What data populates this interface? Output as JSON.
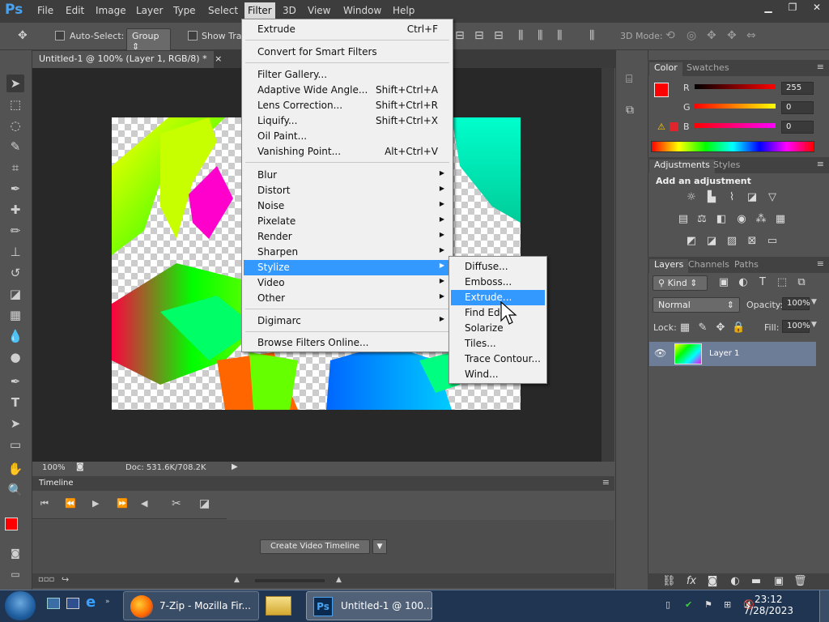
{
  "app": {
    "logo": "Ps"
  },
  "menubar": {
    "items": [
      "File",
      "Edit",
      "Image",
      "Layer",
      "Type",
      "Select",
      "Filter",
      "3D",
      "View",
      "Window",
      "Help"
    ]
  },
  "window_controls": [
    "minimize-icon",
    "restore-icon",
    "close-icon"
  ],
  "options": {
    "auto_select_label": "Auto-Select:",
    "group_value": "Group",
    "show_transform_label": "Show Tran",
    "mode_3d_label": "3D Mode:"
  },
  "document": {
    "tab_title": "Untitled-1 @ 100% (Layer 1, RGB/8) *",
    "zoom": "100%",
    "doc_info": "Doc: 531.6K/708.2K"
  },
  "filter_menu": {
    "items": [
      {
        "label": "Extrude",
        "shortcut": "Ctrl+F"
      },
      {
        "label": "Convert for Smart Filters",
        "shortcut": ""
      },
      {
        "label": "Filter Gallery...",
        "shortcut": ""
      },
      {
        "label": "Adaptive Wide Angle...",
        "shortcut": "Shift+Ctrl+A"
      },
      {
        "label": "Lens Correction...",
        "shortcut": "Shift+Ctrl+R"
      },
      {
        "label": "Liquify...",
        "shortcut": "Shift+Ctrl+X"
      },
      {
        "label": "Oil Paint...",
        "shortcut": ""
      },
      {
        "label": "Vanishing Point...",
        "shortcut": "Alt+Ctrl+V"
      },
      {
        "label": "Blur",
        "shortcut": ""
      },
      {
        "label": "Distort",
        "shortcut": ""
      },
      {
        "label": "Noise",
        "shortcut": ""
      },
      {
        "label": "Pixelate",
        "shortcut": ""
      },
      {
        "label": "Render",
        "shortcut": ""
      },
      {
        "label": "Sharpen",
        "shortcut": ""
      },
      {
        "label": "Stylize",
        "shortcut": ""
      },
      {
        "label": "Video",
        "shortcut": ""
      },
      {
        "label": "Other",
        "shortcut": ""
      },
      {
        "label": "Digimarc",
        "shortcut": ""
      },
      {
        "label": "Browse Filters Online...",
        "shortcut": ""
      }
    ],
    "highlighted": "Stylize"
  },
  "stylize_submenu": {
    "items": [
      "Diffuse...",
      "Emboss...",
      "Extrude...",
      "Find Edges...",
      "Solarize",
      "Tiles...",
      "Trace Contour...",
      "Wind..."
    ],
    "highlighted": "Extrude...",
    "find_edges_visible": "Find Edg"
  },
  "timeline": {
    "title": "Timeline",
    "create_button": "Create Video Timeline"
  },
  "color_panel": {
    "tabs": [
      "Color",
      "Swatches"
    ],
    "r_label": "R",
    "g_label": "G",
    "b_label": "B",
    "r": "255",
    "g": "0",
    "b": "0",
    "foreground": "#ff0000"
  },
  "adjustments_panel": {
    "tabs": [
      "Adjustments",
      "Styles"
    ],
    "subtitle": "Add an adjustment"
  },
  "layers_panel": {
    "tabs": [
      "Layers",
      "Channels",
      "Paths"
    ],
    "kind": "Kind",
    "blend_mode": "Normal",
    "opacity_label": "Opacity:",
    "opacity": "100%",
    "lock_label": "Lock:",
    "fill_label": "Fill:",
    "fill": "100%",
    "layer_name": "Layer 1"
  },
  "taskbar": {
    "firefox_label": "7-Zip - Mozilla Fir...",
    "ps_label": "Untitled-1 @ 100...",
    "time": "23:12",
    "date": "7/28/2023"
  }
}
